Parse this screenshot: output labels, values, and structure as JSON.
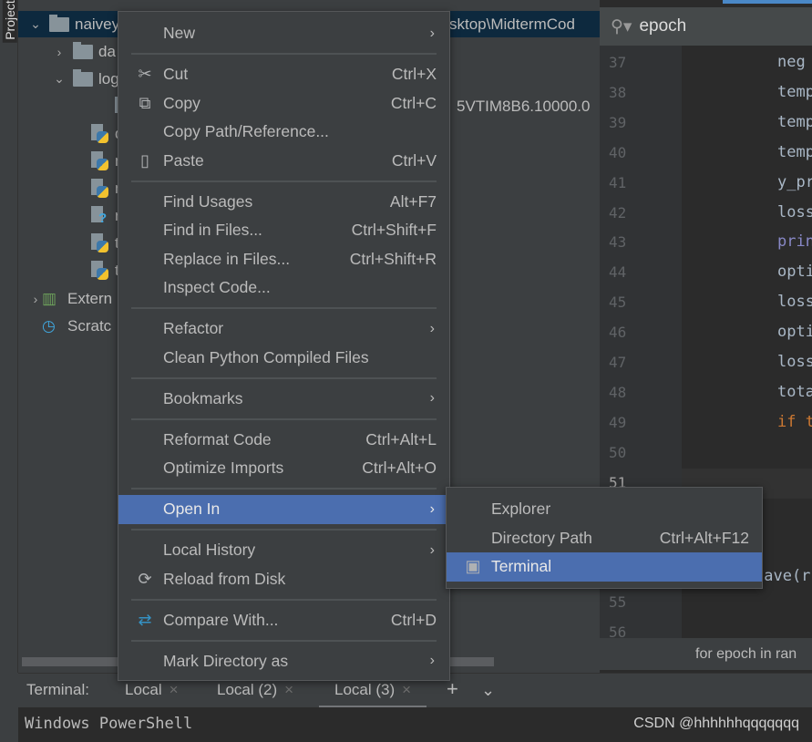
{
  "sidebar": {
    "label": "Project"
  },
  "tree": [
    {
      "label": "naivey",
      "chev": "⌄",
      "icon": "folder-icon",
      "indent": 0,
      "selected": true,
      "suffix": "sktop\\MidtermCod"
    },
    {
      "label": "da",
      "chev": "›",
      "icon": "folder-icon",
      "indent": 1
    },
    {
      "label": "log",
      "chev": "⌄",
      "icon": "folder-icon",
      "indent": 1
    },
    {
      "label": "",
      "icon": "unknown-file-icon",
      "indent": 3,
      "suffix": "5VTIM8B6.10000.0"
    },
    {
      "label": "dr",
      "icon": "python-file-icon",
      "indent": 2
    },
    {
      "label": "mo",
      "icon": "python-file-icon",
      "indent": 2
    },
    {
      "label": "my",
      "icon": "python-file-icon",
      "indent": 2
    },
    {
      "label": "res",
      "icon": "unknown-file-icon",
      "indent": 2
    },
    {
      "label": "tes",
      "icon": "python-file-icon",
      "indent": 2
    },
    {
      "label": "tra",
      "icon": "python-file-icon",
      "indent": 2
    },
    {
      "label": "Extern",
      "chev": "›",
      "icon": "library-icon",
      "indent": 0
    },
    {
      "label": "Scratc",
      "icon": "scratches-icon",
      "indent": 0
    }
  ],
  "search": {
    "value": "epoch"
  },
  "editor": {
    "lines": [
      "37",
      "38",
      "39",
      "40",
      "41",
      "42",
      "43",
      "44",
      "45",
      "46",
      "47",
      "48",
      "49",
      "50",
      "51",
      "52",
      "53",
      "54",
      "55",
      "56"
    ],
    "code": [
      {
        "text": "neg",
        "color": "#a9b7c6"
      },
      {
        "text": "temp",
        "color": "#a9b7c6"
      },
      {
        "text": "temp",
        "color": "#a9b7c6"
      },
      {
        "text": "temp",
        "color": "#a9b7c6"
      },
      {
        "text": "y_pr",
        "color": "#a9b7c6"
      },
      {
        "text": "loss",
        "color": "#a9b7c6"
      },
      {
        "text": "prin",
        "color": "#8888c6"
      },
      {
        "text": "opti",
        "color": "#a9b7c6"
      },
      {
        "text": "loss",
        "color": "#a9b7c6"
      },
      {
        "text": "opti",
        "color": "#a9b7c6"
      },
      {
        "text": "loss",
        "color": "#a9b7c6"
      },
      {
        "text": "tota",
        "color": "#a9b7c6"
      },
      {
        "text": "if t",
        "color": "#cc7832"
      }
    ],
    "save_fragment": "save(r",
    "breadcrumb": "for epoch in ran"
  },
  "menu": [
    {
      "label": "New",
      "arrow": true
    },
    {
      "sep": true
    },
    {
      "label": "Cut",
      "shortcut": "Ctrl+X",
      "icon": "✂",
      "icon_name": "scissors-icon"
    },
    {
      "label": "Copy",
      "shortcut": "Ctrl+C",
      "icon": "⧉",
      "icon_name": "copy-icon"
    },
    {
      "label": "Copy Path/Reference..."
    },
    {
      "label": "Paste",
      "shortcut": "Ctrl+V",
      "icon": "▯",
      "icon_name": "clipboard-icon"
    },
    {
      "sep": true
    },
    {
      "label": "Find Usages",
      "shortcut": "Alt+F7"
    },
    {
      "label": "Find in Files...",
      "shortcut": "Ctrl+Shift+F"
    },
    {
      "label": "Replace in Files...",
      "shortcut": "Ctrl+Shift+R"
    },
    {
      "label": "Inspect Code..."
    },
    {
      "sep": true
    },
    {
      "label": "Refactor",
      "arrow": true
    },
    {
      "label": "Clean Python Compiled Files"
    },
    {
      "sep": true
    },
    {
      "label": "Bookmarks",
      "arrow": true
    },
    {
      "sep": true
    },
    {
      "label": "Reformat Code",
      "shortcut": "Ctrl+Alt+L"
    },
    {
      "label": "Optimize Imports",
      "shortcut": "Ctrl+Alt+O"
    },
    {
      "sep": true
    },
    {
      "label": "Open In",
      "arrow": true,
      "highlighted": true
    },
    {
      "sep": true
    },
    {
      "label": "Local History",
      "arrow": true
    },
    {
      "label": "Reload from Disk",
      "icon": "⟳",
      "icon_name": "reload-icon"
    },
    {
      "sep": true
    },
    {
      "label": "Compare With...",
      "shortcut": "Ctrl+D",
      "icon": "⇄",
      "icon_name": "compare-icon",
      "icon_color": "#3592c4"
    },
    {
      "sep": true
    },
    {
      "label": "Mark Directory as",
      "arrow": true
    }
  ],
  "submenu": [
    {
      "label": "Explorer"
    },
    {
      "label": "Directory Path",
      "shortcut": "Ctrl+Alt+F12"
    },
    {
      "label": "Terminal",
      "highlighted": true,
      "icon": "▣",
      "icon_name": "terminal-icon"
    }
  ],
  "terminal": {
    "label": "Terminal:",
    "tabs": [
      {
        "label": "Local"
      },
      {
        "label": "Local (2)"
      },
      {
        "label": "Local (3)",
        "active": true
      }
    ],
    "output": "Windows PowerShell"
  },
  "watermark": "CSDN @hhhhhhqqqqqqq",
  "colors": {
    "selection": "#4b6eaf",
    "tree_selection": "#0d293e",
    "accent": "#4a88c7"
  }
}
